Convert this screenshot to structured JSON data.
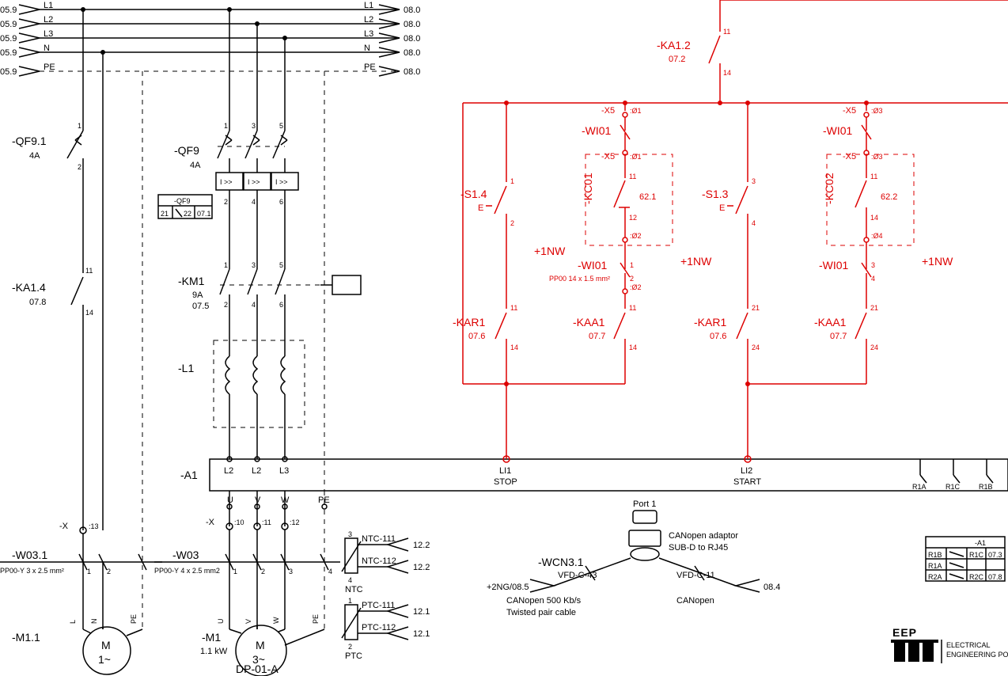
{
  "bus": {
    "lines": [
      {
        "ref_l": "05.9",
        "name": "L1",
        "ref_r": "08.0"
      },
      {
        "ref_l": "05.9",
        "name": "L2",
        "ref_r": "08.0"
      },
      {
        "ref_l": "05.9",
        "name": "L3",
        "ref_r": "08.0"
      },
      {
        "ref_l": "05.9",
        "name": "N",
        "ref_r": "08.0"
      },
      {
        "ref_l": "05.9",
        "name": "PE",
        "ref_r": "08.0"
      }
    ]
  },
  "left": {
    "qf91": {
      "tag": "-QF9.1",
      "rating": "4A",
      "pins": {
        "top": "1",
        "bot": "2"
      }
    },
    "ka14": {
      "tag": "-KA1.4",
      "ref": "07.8",
      "pins": {
        "top": "11",
        "bot": "14"
      }
    },
    "x": {
      "tag": "-X",
      "pin": ":13"
    },
    "w031": {
      "tag": "-W03.1",
      "spec": "PP00-Y 3 x 2.5 mm²",
      "pins": [
        "1",
        "2"
      ]
    },
    "m11": {
      "tag": "-M1.1",
      "text1": "M",
      "text2": "1~",
      "conns": [
        "L",
        "N",
        "PE"
      ]
    }
  },
  "mid": {
    "qf9": {
      "tag": "-QF9",
      "rating": "4A",
      "pins_top": [
        "1",
        "3",
        "5"
      ],
      "pins_bot": [
        "2",
        "4",
        "6"
      ]
    },
    "qf9_table": {
      "title": "-QF9",
      "cells": [
        "21",
        "22",
        "07.1"
      ]
    },
    "km1": {
      "tag": "-KM1",
      "rating": "9A",
      "ref": "07.5",
      "pins_top": [
        "1",
        "3",
        "5"
      ],
      "pins_bot": [
        "2",
        "4",
        "6"
      ]
    },
    "l1": {
      "tag": "-L1"
    },
    "a1": {
      "tag": "-A1",
      "in": [
        "L2",
        "L2",
        "L3"
      ],
      "out": [
        "U",
        "V",
        "W",
        "PE"
      ]
    },
    "x_pins": [
      "-X",
      ":10",
      ":11",
      ":12"
    ],
    "w03": {
      "tag": "-W03",
      "spec": "PP00-Y 4 x 2.5 mm2",
      "pins": [
        "1",
        "2",
        "3",
        "4"
      ]
    },
    "m1": {
      "tag": "-M1",
      "text1": "M",
      "text2": "3~",
      "conns": [
        "U",
        "V",
        "W",
        "PE"
      ],
      "power": "1.1 kW"
    },
    "dp": {
      "tag": "DP-01-A"
    },
    "ntc": {
      "tag": "NTC",
      "a": "NTC-111",
      "b": "NTC-112",
      "ref": "12.2",
      "pins": [
        "3",
        "4"
      ]
    },
    "ptc": {
      "tag": "PTC",
      "a": "PTC-111",
      "b": "PTC-112",
      "ref": "12.1",
      "pins": [
        "1",
        "2"
      ]
    }
  },
  "ctrl": {
    "ka12": {
      "tag": "-KA1.2",
      "ref": "07.2",
      "pins": {
        "top": "11",
        "bot": "14"
      }
    },
    "branchA": {
      "s": {
        "tag": "-S1.4",
        "pins": {
          "top": "1",
          "bot": "2"
        },
        "sym": "E"
      },
      "x5": {
        "tag": "-X5",
        "pin": ":Ø1"
      },
      "wi01": {
        "tag": "-WI01"
      },
      "x5b": {
        "tag": "-X5",
        "pin": ":Ø1"
      },
      "kc": {
        "tag": "-KC01",
        "ref": "62.1",
        "pins": {
          "top": "11",
          "bot": "12"
        }
      },
      "x5c": {
        "pin": ":Ø2"
      },
      "nw": "+1NW",
      "wi01b": {
        "tag": "-WI01",
        "pins": [
          "1",
          "2"
        ],
        "spec": "PP00 14 x 1.5 mm²"
      },
      "x5d": {
        "pin": ":Ø2"
      },
      "kar": {
        "tag": "-KAR1",
        "ref": "07.6",
        "pins": {
          "top": "11",
          "bot": "14"
        }
      },
      "kaa": {
        "tag": "-KAA1",
        "ref": "07.7",
        "pins": {
          "top": "11",
          "bot": "14"
        }
      }
    },
    "branchB": {
      "s": {
        "tag": "-S1.3",
        "pins": {
          "top": "3",
          "bot": "4"
        },
        "sym": "E"
      },
      "x5": {
        "tag": "-X5",
        "pin": ":Ø3"
      },
      "wi01": {
        "tag": "-WI01"
      },
      "x5b": {
        "tag": "-X5",
        "pin": ":Ø3"
      },
      "kc": {
        "tag": "-KC02",
        "ref": "62.2",
        "pins": {
          "top": "11",
          "bot": "14"
        }
      },
      "x5c": {
        "pin": ":Ø4"
      },
      "nw": "+1NW",
      "wi01b": {
        "tag": "-WI01",
        "pins": [
          "3",
          "4"
        ]
      },
      "kar": {
        "tag": "-KAR1",
        "ref": "07.6",
        "pins": {
          "top": "21",
          "bot": "24"
        }
      },
      "kaa": {
        "tag": "-KAA1",
        "ref": "07.7",
        "pins": {
          "top": "21",
          "bot": "24"
        }
      }
    },
    "li": {
      "li1": {
        "tag": "LI1",
        "lbl": "STOP"
      },
      "li2": {
        "tag": "LI2",
        "lbl": "START"
      }
    },
    "r": {
      "a": "R1A",
      "b": "R1C",
      "c": "R1B"
    }
  },
  "comm": {
    "port": "Port 1",
    "adaptor": [
      "CANopen adaptor",
      "SUB-D to RJ45"
    ],
    "wcn": {
      "tag": "-WCN3.1"
    },
    "left": {
      "tag": "VFD-C-43",
      "ref": "+2NG/08.5",
      "notes": [
        "CANopen 500 Kb/s",
        "Twisted pair cable"
      ]
    },
    "right": {
      "tag": "VFD-C-11",
      "ref": "08.4",
      "notes": [
        "CANopen"
      ]
    }
  },
  "a1_table": {
    "title": "-A1",
    "rows": [
      [
        "R1B",
        "R1C",
        "07.3"
      ],
      [
        "R1A",
        "",
        ""
      ],
      [
        "R2A",
        "R2C",
        "07.8"
      ]
    ]
  },
  "logo": {
    "brand": "EEP",
    "sub": [
      "ELECTRICAL",
      "ENGINEERING PORTAL"
    ]
  },
  "icons": {
    "itrip": "I >>"
  }
}
